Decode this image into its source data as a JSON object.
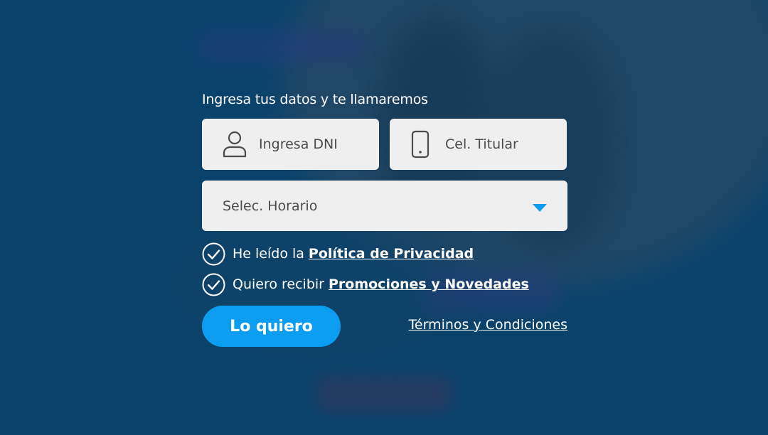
{
  "form": {
    "title": "Ingresa tus datos y te llamaremos",
    "dni_placeholder": "Ingresa DNI",
    "dni_icon": "user-icon",
    "phone_placeholder": "Cel. Titular",
    "phone_icon": "smartphone-icon",
    "schedule_selected": "Selec. Horario",
    "schedule_icon": "caret-down-icon",
    "privacy_label": "He leído la",
    "privacy_link": "Política de Privacidad",
    "promos_label": "Quiero recibir",
    "promos_link": "Promociones y Novedades",
    "submit_label": "Lo quiero",
    "terms_link": "Términos y Condiciones"
  },
  "colors": {
    "background": "#0d4a73",
    "field_bg": "#efefef",
    "accent": "#0c9df0",
    "field_text": "#4b4b4b"
  }
}
